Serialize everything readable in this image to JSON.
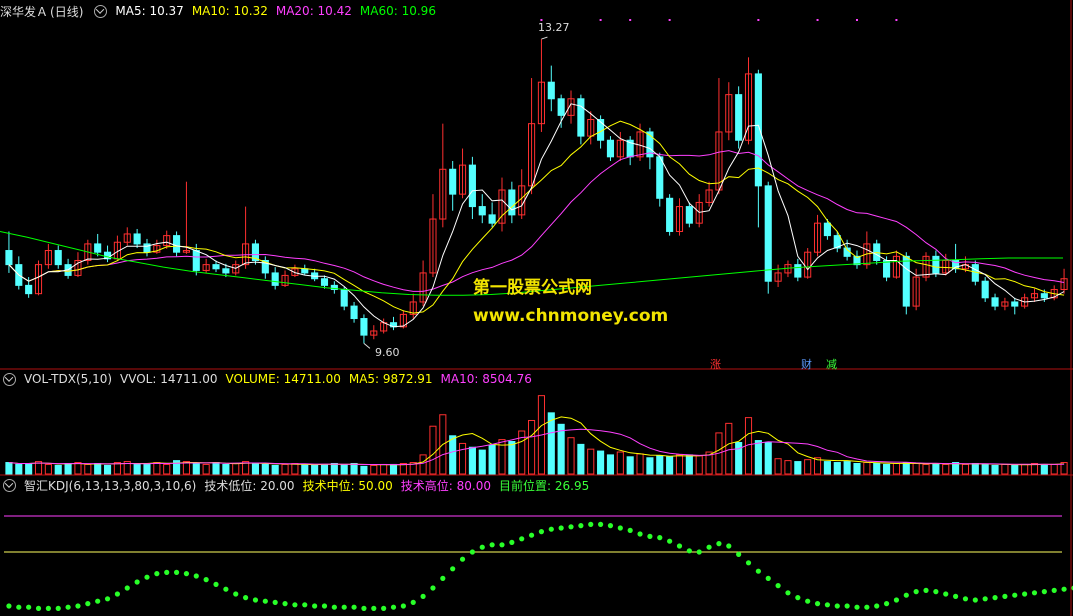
{
  "header_main": {
    "stock": "深华发Ａ",
    "period": "(日线)",
    "ma5": "MA5: 10.37",
    "ma10": "MA10: 10.32",
    "ma20": "MA20: 10.42",
    "ma60": "MA60: 10.96"
  },
  "header_vol": {
    "name": "VOL-TDX(5,10)",
    "vvol": "VVOL: 14711.00",
    "volume": "VOLUME: 14711.00",
    "ma5": "MA5: 9872.91",
    "ma10": "MA10: 8504.76"
  },
  "header_kdj": {
    "name": "智汇KDJ(6,13,13,3,80,3,10,6)",
    "low": "技术低位: 20.00",
    "mid": "技术中位: 50.00",
    "high": "技术高位: 80.00",
    "current": "目前位置: 26.95"
  },
  "annotations": {
    "high_label": "13.27",
    "low_label": "9.60",
    "marker_zhang": "涨",
    "marker_cai": "财",
    "marker_jian": "减"
  },
  "watermark": {
    "line1": "第一股票公式网",
    "line2": "www.chnmoney.com"
  },
  "colors": {
    "up": "#ff3030",
    "down": "#54ffff",
    "ma5": "#ffffff",
    "ma10": "#ffff00",
    "ma20": "#ff40ff",
    "ma60": "#00ff00",
    "kdj_dots": "#28ff28",
    "high_line": "#ff40ff",
    "mid_line": "#ffff60",
    "watermark": "#f2e400"
  },
  "chart_data": {
    "type": "candlestick",
    "price_range": [
      9.4,
      13.5
    ],
    "candles": [
      [
        10.72,
        10.55,
        10.95,
        10.45
      ],
      [
        10.55,
        10.3,
        10.65,
        10.25
      ],
      [
        10.3,
        10.2,
        10.4,
        10.15
      ],
      [
        10.2,
        10.55,
        10.6,
        10.18
      ],
      [
        10.55,
        10.72,
        10.8,
        10.5
      ],
      [
        10.72,
        10.55,
        10.78,
        10.5
      ],
      [
        10.55,
        10.42,
        10.62,
        10.38
      ],
      [
        10.42,
        10.6,
        10.7,
        10.4
      ],
      [
        10.6,
        10.8,
        10.85,
        10.55
      ],
      [
        10.8,
        10.7,
        10.92,
        10.65
      ],
      [
        10.7,
        10.62,
        10.78,
        10.58
      ],
      [
        10.62,
        10.82,
        10.9,
        10.6
      ],
      [
        10.82,
        10.92,
        11.0,
        10.78
      ],
      [
        10.92,
        10.8,
        10.98,
        10.75
      ],
      [
        10.8,
        10.7,
        10.86,
        10.65
      ],
      [
        10.7,
        10.78,
        10.85,
        10.68
      ],
      [
        10.78,
        10.9,
        10.96,
        10.74
      ],
      [
        10.9,
        10.7,
        10.95,
        10.65
      ],
      [
        10.7,
        10.72,
        11.55,
        10.68
      ],
      [
        10.72,
        10.48,
        10.8,
        10.42
      ],
      [
        10.48,
        10.55,
        10.62,
        10.45
      ],
      [
        10.55,
        10.5,
        10.6,
        10.46
      ],
      [
        10.5,
        10.45,
        10.56,
        10.4
      ],
      [
        10.45,
        10.55,
        10.6,
        10.42
      ],
      [
        10.55,
        10.8,
        11.25,
        10.5
      ],
      [
        10.8,
        10.6,
        10.85,
        10.55
      ],
      [
        10.6,
        10.45,
        10.65,
        10.38
      ],
      [
        10.45,
        10.3,
        10.52,
        10.25
      ],
      [
        10.3,
        10.42,
        10.48,
        10.28
      ],
      [
        10.42,
        10.5,
        10.55,
        10.4
      ],
      [
        10.5,
        10.45,
        10.55,
        10.42
      ],
      [
        10.45,
        10.38,
        10.5,
        10.35
      ],
      [
        10.38,
        10.3,
        10.42,
        10.26
      ],
      [
        10.3,
        10.25,
        10.35,
        10.2
      ],
      [
        10.25,
        10.05,
        10.28,
        10.0
      ],
      [
        10.05,
        9.9,
        10.1,
        9.85
      ],
      [
        9.9,
        9.7,
        9.95,
        9.6
      ],
      [
        9.7,
        9.75,
        9.82,
        9.65
      ],
      [
        9.75,
        9.85,
        9.9,
        9.72
      ],
      [
        9.85,
        9.8,
        9.92,
        9.76
      ],
      [
        9.8,
        9.95,
        10.0,
        9.78
      ],
      [
        9.95,
        10.1,
        10.2,
        9.9
      ],
      [
        10.1,
        10.45,
        10.6,
        10.05
      ],
      [
        10.45,
        11.1,
        11.4,
        10.4
      ],
      [
        11.1,
        11.7,
        12.25,
        11.0
      ],
      [
        11.7,
        11.4,
        11.8,
        11.2
      ],
      [
        11.4,
        11.75,
        11.95,
        11.35
      ],
      [
        11.75,
        11.25,
        11.85,
        11.1
      ],
      [
        11.25,
        11.15,
        11.4,
        11.05
      ],
      [
        11.15,
        11.05,
        11.3,
        11.0
      ],
      [
        11.05,
        11.45,
        11.6,
        10.95
      ],
      [
        11.45,
        11.15,
        11.55,
        11.05
      ],
      [
        11.15,
        11.5,
        11.7,
        11.1
      ],
      [
        11.5,
        12.25,
        12.8,
        11.4
      ],
      [
        12.25,
        12.75,
        13.27,
        12.15
      ],
      [
        12.75,
        12.55,
        12.95,
        12.4
      ],
      [
        12.55,
        12.35,
        12.6,
        12.2
      ],
      [
        12.35,
        12.55,
        12.65,
        12.25
      ],
      [
        12.55,
        12.1,
        12.6,
        12.0
      ],
      [
        12.1,
        12.3,
        12.4,
        12.0
      ],
      [
        12.3,
        12.05,
        12.35,
        11.95
      ],
      [
        12.05,
        11.85,
        12.1,
        11.8
      ],
      [
        11.85,
        12.05,
        12.15,
        11.8
      ],
      [
        12.05,
        11.85,
        12.1,
        11.75
      ],
      [
        11.85,
        12.15,
        12.25,
        11.8
      ],
      [
        12.15,
        11.85,
        12.2,
        11.7
      ],
      [
        11.85,
        11.35,
        11.9,
        11.25
      ],
      [
        11.35,
        10.95,
        11.4,
        10.9
      ],
      [
        10.95,
        11.25,
        11.35,
        10.9
      ],
      [
        11.25,
        11.05,
        11.3,
        11.0
      ],
      [
        11.05,
        11.3,
        11.4,
        11.0
      ],
      [
        11.3,
        11.45,
        11.55,
        11.25
      ],
      [
        11.45,
        12.15,
        12.8,
        11.4
      ],
      [
        12.15,
        12.6,
        12.75,
        12.05
      ],
      [
        12.6,
        12.05,
        12.7,
        11.95
      ],
      [
        12.05,
        12.85,
        13.05,
        12.0
      ],
      [
        12.85,
        11.5,
        12.9,
        11.0
      ],
      [
        11.5,
        10.35,
        11.55,
        10.2
      ],
      [
        10.35,
        10.45,
        10.55,
        10.28
      ],
      [
        10.45,
        10.55,
        10.6,
        10.4
      ],
      [
        10.55,
        10.4,
        10.62,
        10.35
      ],
      [
        10.4,
        10.7,
        10.75,
        10.38
      ],
      [
        10.7,
        11.05,
        11.15,
        10.65
      ],
      [
        11.05,
        10.9,
        11.1,
        10.85
      ],
      [
        10.9,
        10.75,
        10.95,
        10.7
      ],
      [
        10.75,
        10.65,
        10.85,
        10.6
      ],
      [
        10.65,
        10.55,
        10.72,
        10.5
      ],
      [
        10.55,
        10.8,
        10.95,
        10.5
      ],
      [
        10.8,
        10.6,
        10.85,
        10.55
      ],
      [
        10.6,
        10.4,
        10.65,
        10.35
      ],
      [
        10.4,
        10.65,
        10.72,
        10.38
      ],
      [
        10.65,
        10.05,
        10.7,
        9.95
      ],
      [
        10.05,
        10.4,
        10.5,
        10.0
      ],
      [
        10.4,
        10.65,
        10.7,
        10.35
      ],
      [
        10.65,
        10.45,
        10.72,
        10.4
      ],
      [
        10.45,
        10.6,
        10.68,
        10.42
      ],
      [
        10.6,
        10.5,
        10.8,
        10.45
      ],
      [
        10.5,
        10.55,
        10.65,
        10.46
      ],
      [
        10.55,
        10.35,
        10.6,
        10.3
      ],
      [
        10.35,
        10.15,
        10.4,
        10.1
      ],
      [
        10.15,
        10.05,
        10.2,
        10.0
      ],
      [
        10.05,
        10.1,
        10.15,
        10.0
      ],
      [
        10.1,
        10.05,
        10.15,
        9.95
      ],
      [
        10.05,
        10.15,
        10.2,
        10.02
      ],
      [
        10.15,
        10.2,
        10.26,
        10.1
      ],
      [
        10.2,
        10.15,
        10.25,
        10.1
      ],
      [
        10.15,
        10.25,
        10.3,
        10.12
      ],
      [
        10.25,
        10.38,
        10.5,
        10.2
      ]
    ],
    "ma60": [
      10.95,
      10.88,
      10.8,
      10.72,
      10.64,
      10.58,
      10.52,
      10.47,
      10.43,
      10.39,
      10.35,
      10.31,
      10.27,
      10.24,
      10.21,
      10.19,
      10.18,
      10.18,
      10.19,
      10.21,
      10.24,
      10.27,
      10.3,
      10.33,
      10.36,
      10.39,
      10.42,
      10.45,
      10.48,
      10.51,
      10.53,
      10.55,
      10.57,
      10.59,
      10.6,
      10.61,
      10.62,
      10.63,
      10.63,
      10.63
    ],
    "volume": [
      1.2,
      1.0,
      1.1,
      1.3,
      1.0,
      0.9,
      1.1,
      1.2,
      1.0,
      1.1,
      0.9,
      1.2,
      1.3,
      1.0,
      1.1,
      1.2,
      1.0,
      1.4,
      1.3,
      1.1,
      1.0,
      1.2,
      1.0,
      1.1,
      1.3,
      1.1,
      1.0,
      0.9,
      1.0,
      1.1,
      1.0,
      0.9,
      1.0,
      1.1,
      1.0,
      1.1,
      0.8,
      0.9,
      1.0,
      1.0,
      1.1,
      1.2,
      2.0,
      5.0,
      6.2,
      4.0,
      3.2,
      2.8,
      2.5,
      3.0,
      3.6,
      3.4,
      4.5,
      5.6,
      8.2,
      6.4,
      5.2,
      3.8,
      3.1,
      2.6,
      2.4,
      2.0,
      2.3,
      1.8,
      2.1,
      1.7,
      1.9,
      1.8,
      2.0,
      2.0,
      1.9,
      2.3,
      4.3,
      5.3,
      3.3,
      5.9,
      3.5,
      3.3,
      1.6,
      1.4,
      1.3,
      1.5,
      1.7,
      1.3,
      1.2,
      1.3,
      1.1,
      1.2,
      1.1,
      1.0,
      1.1,
      1.2,
      1.1,
      1.0,
      1.1,
      1.0,
      1.2,
      1.0,
      1.1,
      1.0,
      0.9,
      1.0,
      0.9,
      1.0,
      1.1,
      1.0,
      1.0,
      1.2
    ],
    "vol_max": 9.0,
    "kdj": [
      5,
      4,
      4,
      3,
      3,
      3,
      4,
      5,
      7,
      9,
      11,
      15,
      20,
      25,
      29,
      32,
      33,
      33,
      32,
      30,
      27,
      23,
      19,
      15,
      12,
      10,
      9,
      8,
      7,
      6,
      6,
      5,
      5,
      4,
      4,
      4,
      3,
      3,
      3,
      4,
      5,
      8,
      13,
      20,
      28,
      36,
      44,
      50,
      54,
      56,
      56,
      58,
      61,
      64,
      67,
      69,
      70,
      71,
      72,
      73,
      73,
      72,
      70,
      68,
      65,
      63,
      62,
      59,
      55,
      51,
      50,
      54,
      57,
      55,
      48,
      41,
      34,
      28,
      22,
      16,
      12,
      9,
      7,
      6,
      5,
      5,
      4,
      4,
      5,
      7,
      10,
      14,
      17,
      18,
      17,
      15,
      13,
      11,
      10,
      11,
      12,
      13,
      14,
      15,
      16,
      17,
      18,
      19,
      20,
      21
    ],
    "kdj_levels": {
      "low": 20,
      "mid": 50,
      "high": 80
    }
  }
}
